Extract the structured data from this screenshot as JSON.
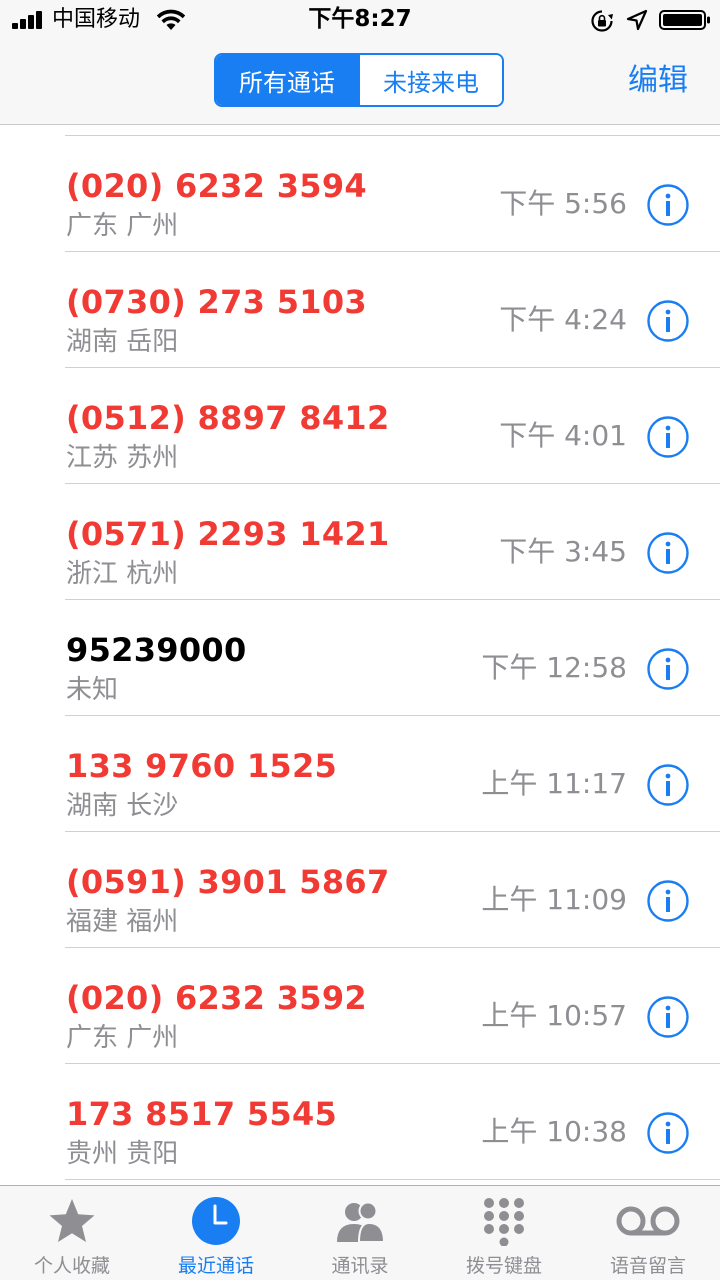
{
  "status_bar": {
    "carrier": "中国移动",
    "time": "下午8:27"
  },
  "nav": {
    "segments": [
      "所有通话",
      "未接来电"
    ],
    "selected_segment": "所有通话",
    "edit_label": "编辑"
  },
  "calls": [
    {
      "number": "(020) 6232 3594",
      "location": "广东 广州",
      "time": "下午 5:56",
      "missed": true
    },
    {
      "number": "(0730) 273 5103",
      "location": "湖南 岳阳",
      "time": "下午 4:24",
      "missed": true
    },
    {
      "number": "(0512) 8897 8412",
      "location": "江苏 苏州",
      "time": "下午 4:01",
      "missed": true
    },
    {
      "number": "(0571) 2293 1421",
      "location": "浙江 杭州",
      "time": "下午 3:45",
      "missed": true
    },
    {
      "number": "95239000",
      "location": "未知",
      "time": "下午 12:58",
      "missed": false
    },
    {
      "number": "133 9760 1525",
      "location": "湖南 长沙",
      "time": "上午 11:17",
      "missed": true
    },
    {
      "number": "(0591) 3901 5867",
      "location": "福建 福州",
      "time": "上午 11:09",
      "missed": true
    },
    {
      "number": "(020) 6232 3592",
      "location": "广东 广州",
      "time": "上午 10:57",
      "missed": true
    },
    {
      "number": "173 8517 5545",
      "location": "贵州 贵阳",
      "time": "上午 10:38",
      "missed": true
    }
  ],
  "tab_bar": {
    "tabs": [
      {
        "label": "个人收藏",
        "icon": "star-icon"
      },
      {
        "label": "最近通话",
        "icon": "clock-icon"
      },
      {
        "label": "通讯录",
        "icon": "contacts-icon"
      },
      {
        "label": "拨号键盘",
        "icon": "keypad-icon"
      },
      {
        "label": "语音留言",
        "icon": "voicemail-icon"
      }
    ],
    "active_tab": "最近通话"
  },
  "colors": {
    "accent": "#1a7ef3",
    "missed": "#f03a33",
    "secondary_text": "#8e8e93"
  }
}
